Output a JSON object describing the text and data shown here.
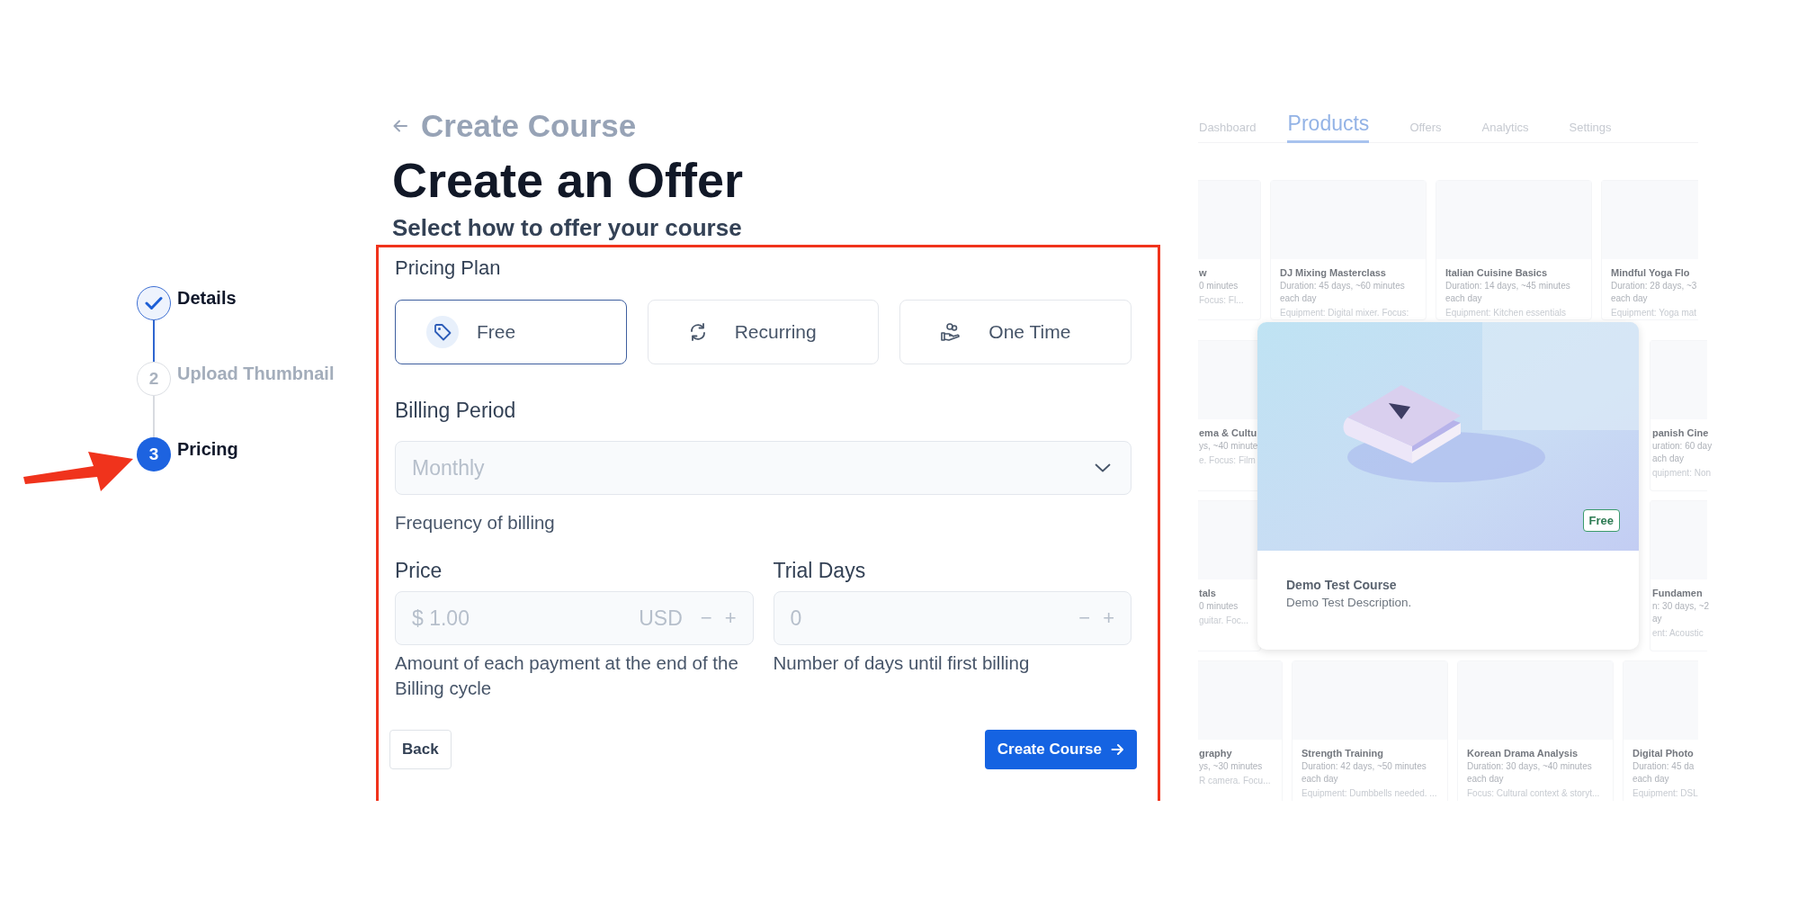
{
  "stepper": [
    {
      "label": "Details",
      "completed": true,
      "selected": false
    },
    {
      "number": "2",
      "label": "Upload Thumbnail",
      "completed": false,
      "selected": false
    },
    {
      "number": "3",
      "label": "Pricing",
      "completed": false,
      "selected": true
    }
  ],
  "header": {
    "back_link": "Create Course",
    "title": "Create an Offer",
    "subtitle": "Select how to offer your course"
  },
  "pricing_plan": {
    "label": "Pricing Plan",
    "options": [
      {
        "kind": "free",
        "label": "Free",
        "selected": true
      },
      {
        "kind": "recurring",
        "label": "Recurring",
        "selected": false
      },
      {
        "kind": "onetime",
        "label": "One Time",
        "selected": false
      }
    ]
  },
  "billing_period": {
    "label": "Billing Period",
    "value": "Monthly",
    "disabled": true,
    "help": "Frequency of billing"
  },
  "price": {
    "label": "Price",
    "value": "$ 1.00",
    "currency": "USD",
    "decrement": "−",
    "increment": "+",
    "disabled": true,
    "help": "Amount of each payment at the end of the Billing cycle"
  },
  "trial_days": {
    "label": "Trial Days",
    "value": "0",
    "decrement": "−",
    "increment": "+",
    "disabled": true,
    "help": "Number of days until first billing"
  },
  "actions": {
    "back": "Back",
    "submit": "Create Course"
  },
  "preview": {
    "nav": [
      {
        "label": "Dashboard",
        "selected": false
      },
      {
        "label": "Products",
        "selected": true
      },
      {
        "label": "Offers",
        "selected": false
      },
      {
        "label": "Analytics",
        "selected": false
      },
      {
        "label": "Settings",
        "selected": false
      }
    ],
    "rows": [
      {
        "cards": [
          {
            "kind": "left",
            "title": "w",
            "lines": [
              "0 minutes",
              "Focus: Fl..."
            ]
          },
          {
            "kind": "full",
            "title": "DJ Mixing Masterclass",
            "lines": [
              "Duration: 45 days, ~60 minutes each day",
              "Equipment: Digital mixer. Focus:"
            ]
          },
          {
            "kind": "full",
            "title": "Italian Cuisine Basics",
            "lines": [
              "Duration: 14 days, ~45 minutes each day",
              "Equipment: Kitchen essentials"
            ]
          },
          {
            "kind": "right",
            "title": "Mindful Yoga Flo",
            "lines": [
              "Duration: 28 days, ~3",
              "each day",
              "Equipment: Yoga mat"
            ]
          }
        ]
      },
      {
        "cards": [
          {
            "kind": "left",
            "title": "ema & Cultu",
            "lines": [
              "ys, ~40 minute",
              "e. Focus: Film"
            ]
          },
          {
            "kind": "right",
            "title": "panish Cine",
            "lines": [
              "uration: 60 day",
              "ach day",
              "quipment: Non"
            ]
          }
        ]
      },
      {
        "cards": [
          {
            "kind": "left",
            "title": "tals",
            "lines": [
              "0 minutes",
              "guitar. Foc..."
            ]
          },
          {
            "kind": "right",
            "title": "Fundamen",
            "lines": [
              "n: 30 days, ~2",
              "ay",
              "ent: Acoustic"
            ]
          }
        ]
      },
      {
        "cards": [
          {
            "kind": "left",
            "title": "graphy",
            "lines": [
              "ys, ~30 minutes",
              "R camera. Focu..."
            ]
          },
          {
            "kind": "full",
            "title": "Strength Training",
            "lines": [
              "Duration: 42 days, ~50 minutes each day",
              "Equipment: Dumbbells needed. ..."
            ]
          },
          {
            "kind": "full",
            "title": "Korean Drama Analysis",
            "lines": [
              "Duration: 30 days, ~40 minutes each day",
              "Focus: Cultural context & storyt..."
            ]
          },
          {
            "kind": "right",
            "title": "Digital Photo",
            "lines": [
              "Duration: 45 da",
              "each day",
              "Equipment: DSL"
            ]
          }
        ]
      }
    ],
    "featured": {
      "badge": "Free",
      "title": "Demo Test Course",
      "description": "Demo Test Description."
    }
  }
}
